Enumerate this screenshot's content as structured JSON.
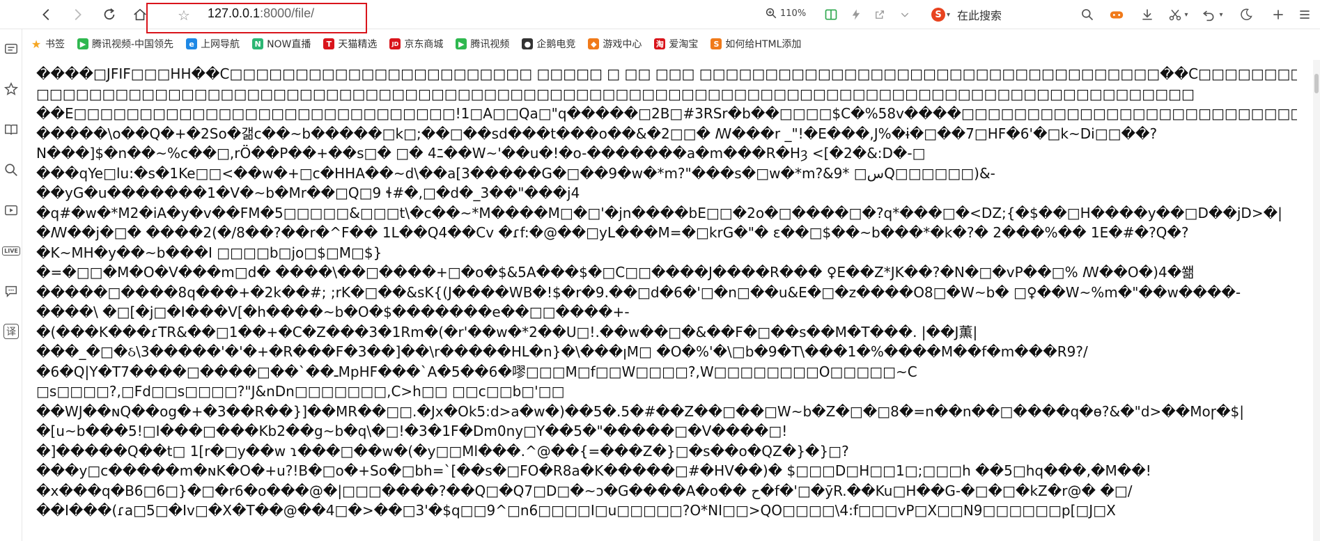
{
  "toolbar": {
    "url_host": "127.0.0.1",
    "url_rest": ":8000/file/",
    "zoom": "110%",
    "search_placeholder": "在此搜索"
  },
  "bookmarks": [
    {
      "label": "书签",
      "icon": "star-icon",
      "color": "#f5a623"
    },
    {
      "label": "腾讯视频-中国领先",
      "icon": "tencent-video-icon",
      "color": "#2fb84f"
    },
    {
      "label": "上网导航",
      "icon": "ie-icon",
      "color": "#1e88e5"
    },
    {
      "label": "NOW直播",
      "icon": "now-icon",
      "color": "#2bb673"
    },
    {
      "label": "天猫精选",
      "icon": "tmall-icon",
      "color": "#d9141b"
    },
    {
      "label": "京东商城",
      "icon": "jd-icon",
      "color": "#d9141b"
    },
    {
      "label": "腾讯视频",
      "icon": "tencent-video-icon",
      "color": "#2fb84f"
    },
    {
      "label": "企鹅电竞",
      "icon": "penguin-icon",
      "color": "#333333"
    },
    {
      "label": "游戏中心",
      "icon": "game-icon",
      "color": "#f07a1a"
    },
    {
      "label": "爱淘宝",
      "icon": "taobao-icon",
      "color": "#d9141b"
    },
    {
      "label": "如何给HTML添加",
      "icon": "sogou-icon",
      "color": "#f07a1a"
    }
  ],
  "content_lines": [
    "����□JFIF□□□HH��C□□□□□□□□□□□□□□□□□□□□□□□ □□□□□ □ □□ □□□ □□□□□□□□□□□□□□□□□□□□□□□□□□□□□□□□□□□��C□□□□□□□□□ □□ □ □",
    "□□□□□□□□□□□□□□□□□□□□□□□□□□□□□□□□□□□□□□□□□□□□□□□□□□□□□□□□□□□□□□□□□□□□□□□□□□□□□□□□□□□□□□□□",
    "��E□□□□□□□□□□□□□□□□□□□□□□□□□□□□□!1□A□□Qa□\"q�����□2B□#3RSr�b��□□□□$C�%58v����□□□□□□□□□□□□□□□□□□□□□□□□□□��>□□□□□□□□□□□□□□□□□□□□□□□□□□□□□□!1□A",
    "�����\\o��Q�+�2So�갦c��~b�����□k□;��□��sd���t���o��&�2□□�    ꟿ���r _\"!�E���,J%�ɨ�□��7□HF�6'�□k~Di□□��?",
    "N���]$�n��~%c��□,rÖ��P��+��s□� □�   4ﾆ��W~'��u�!�o-�������a�m���R�Hȝ <[�2�&:D�-□",
    "���qYe□lu:�s�1Ke□□<��w�+□c�HHA��~d\\��a[3�����G�□��9�w�*m?\"���s�□w�*m?&9*     □سQ□□□□□□)&-",
    "��yG�u�������1�V�~b�Mr��□Q□9   ɬ#�,□�d�_3��\"���j4",
    "�q#�w�*M2�iA�y�v��FM�5□□□□□&□□□t\\�c��~*M����M□�□'�jn����bE□□�2o�□����□�?q*���□�<DZ;{�$��□H����y��□D��jD>�|",
    "�ꟿ��j�□� ����2(�/8��?��r�^F�� 1L��Q4��Cv �ɾf:�@��□yL���M=�□krG�\"�   ɛ��□$��~b���*�k�?� 2���%�� 1E�#�?Q�?",
    "�K~MH�y��~b���I □□□□b□jo□$□M□$}",
    "�=�□□�M�O�V���m□d� ����\\��□����+□�o�$&5A���$�□C□□����J����R���     ♀E��Z*JK��?�N�□�vP��□%  ꟿ��O�)4�쐚",
    "�����□����8q���+�2k��#; ;rK�□��&sK{(J����WB�!$�r�9.��□d�6�'□�n□��u&E�□�z����O8□�W~b�     □♀��W~%m�\"��w����-",
    "����\\ �□[�j□�I���V[�h����~b�O�$�������e��□□����+-",
    "�(���K���ɾTR&��□1��+�C�Z���3�1Rm�(�r'��w�*2��U□!.��w��□�&��F�□��s��M�T���. |��J薫|",
    "���_�□�ઠ\\3�����'�'�+�R���F�3��]��\\r�����HԼ�n}�\\���ꞁM□ �O�%'�\\□b�9�T\\���1�%����M��f�m���R9?/",
    "�6�Q|Y�T7����□����□��`��ـMpHF���`A�5��6�嘐□□□M□f□□W□□□□?,W□□□□□□□□O□□□□□~C",
    "□s□□□□?,□Fd□□s□□□□?\"J&nDn□□□□□□□,C>h□□ □□c□□b□'□□",
    "��WJ��ɴQ��og�+�3��R��}]��MR��□□.�Jx�Ok5:d>a�w�)��5�.5�#��Z��□��□W~b�Z�□�□8�=n��n��□����q�ɵ?&�\"d>��Moɼ�$|",
    "�[u~b���5!□I���□���Kb2��g~b�q\\�□!�3�1F�Dm0ny□Y��5�\"�����□�V����□!",
    "�]�����Q��t□ 1[r�□y��w  ɿ���□��w�(�y□□Ml���.^@��{=���Z�}□�s��o�QZ�}�}□?",
    "���y□c�����m�ɴK�O�+u?!B�□o�+So�□bh=`[��s�□FO�R8a�K�����□#�HV��)� $□□□D□H□□1□;□□□h  ��5□hq���,�M��!",
    "�x���q�B6□6□}�□�r6�o���@�|□□□����?��Q□�Q7□D□�~ɔ�G����A�o��     ح�f�'□�ӯR.��Ku□H��G-�□�□�kZ�r@� �□/",
    "��I���(ɾa□5□�Iv□�X�T��@��4□�>��□3'�$q□□9^□n6□□□□I□u□□□□□?O*NI□□>QO□□□□\\4:f□□□vP□X□□N9□□□□□□p[□J□X"
  ]
}
